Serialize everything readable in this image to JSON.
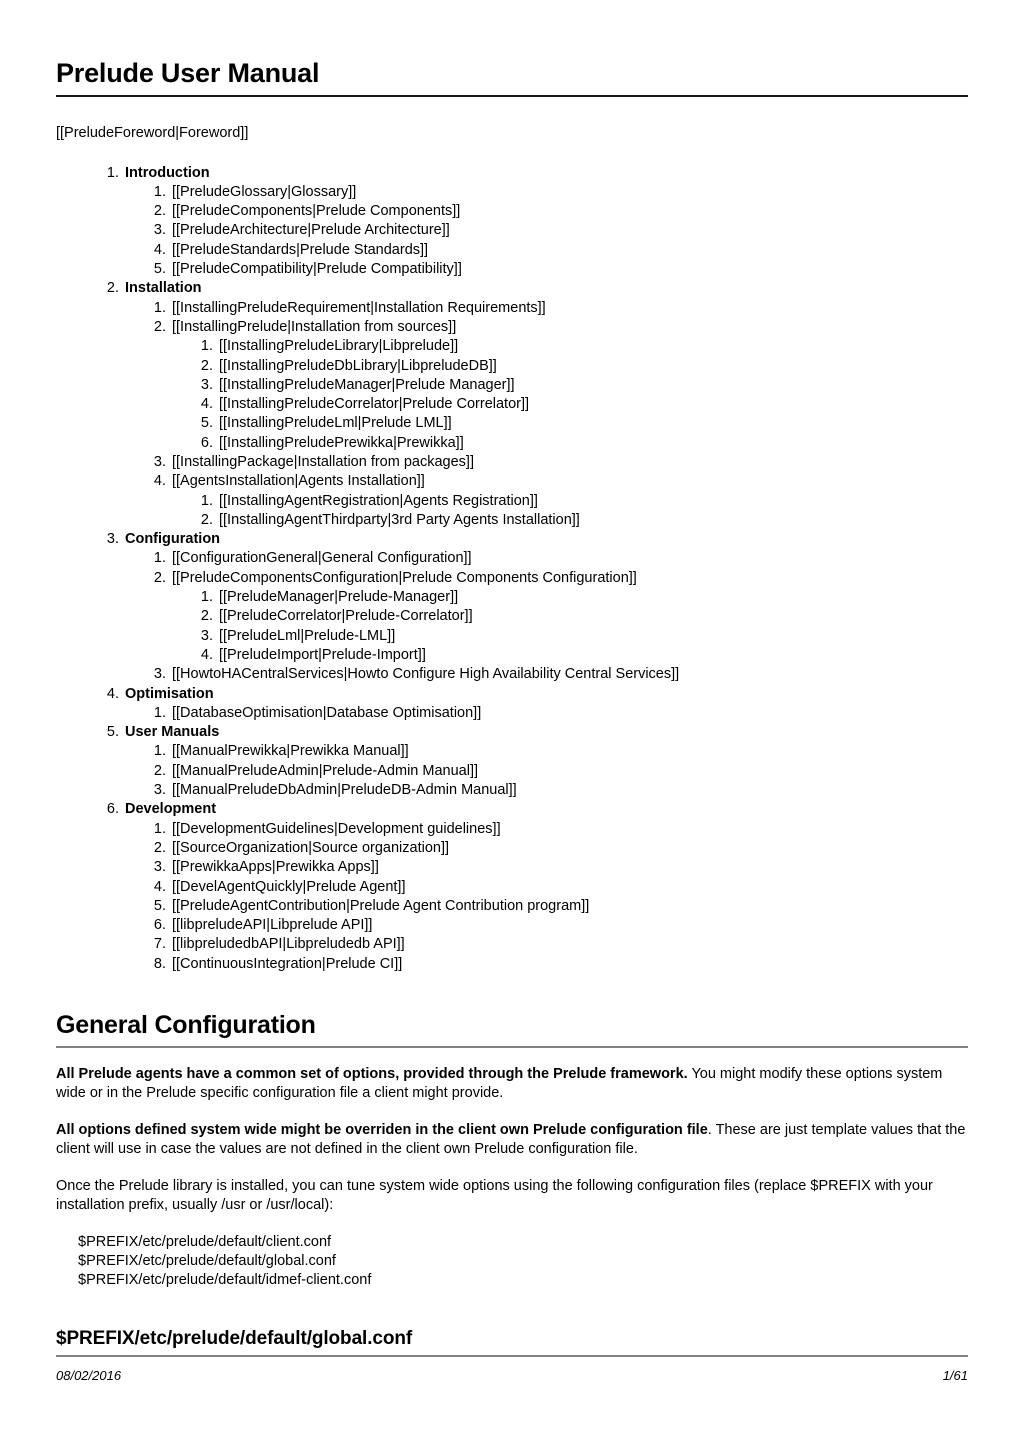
{
  "document": {
    "title": "Prelude User Manual",
    "foreword": "[[PreludeForeword|Foreword]]"
  },
  "toc": [
    {
      "label": "Introduction",
      "children": [
        {
          "label": "[[PreludeGlossary|Glossary]]"
        },
        {
          "label": "[[PreludeComponents|Prelude Components]]"
        },
        {
          "label": "[[PreludeArchitecture|Prelude Architecture]]"
        },
        {
          "label": "[[PreludeStandards|Prelude Standards]]"
        },
        {
          "label": "[[PreludeCompatibility|Prelude Compatibility]]"
        }
      ]
    },
    {
      "label": "Installation",
      "children": [
        {
          "label": "[[InstallingPreludeRequirement|Installation Requirements]]"
        },
        {
          "label": "[[InstallingPrelude|Installation from sources]]",
          "children": [
            {
              "label": "[[InstallingPreludeLibrary|Libprelude]]"
            },
            {
              "label": "[[InstallingPreludeDbLibrary|LibpreludeDB]]"
            },
            {
              "label": "[[InstallingPreludeManager|Prelude Manager]]"
            },
            {
              "label": "[[InstallingPreludeCorrelator|Prelude Correlator]]"
            },
            {
              "label": "[[InstallingPreludeLml|Prelude LML]]"
            },
            {
              "label": "[[InstallingPreludePrewikka|Prewikka]]"
            }
          ]
        },
        {
          "label": "[[InstallingPackage|Installation from packages]]"
        },
        {
          "label": "[[AgentsInstallation|Agents Installation]]",
          "children": [
            {
              "label": "[[InstallingAgentRegistration|Agents Registration]]"
            },
            {
              "label": "[[InstallingAgentThirdparty|3rd Party Agents Installation]]"
            }
          ]
        }
      ]
    },
    {
      "label": "Configuration",
      "children": [
        {
          "label": "[[ConfigurationGeneral|General Configuration]]"
        },
        {
          "label": "[[PreludeComponentsConfiguration|Prelude Components Configuration]]",
          "children": [
            {
              "label": "[[PreludeManager|Prelude-Manager]]"
            },
            {
              "label": "[[PreludeCorrelator|Prelude-Correlator]]"
            },
            {
              "label": "[[PreludeLml|Prelude-LML]]"
            },
            {
              "label": "[[PreludeImport|Prelude-Import]]"
            }
          ]
        },
        {
          "label": "[[HowtoHACentralServices|Howto Configure High Availability Central Services]]"
        }
      ]
    },
    {
      "label": "Optimisation",
      "children": [
        {
          "label": "[[DatabaseOptimisation|Database Optimisation]]"
        }
      ]
    },
    {
      "label": "User Manuals",
      "children": [
        {
          "label": "[[ManualPrewikka|Prewikka Manual]]"
        },
        {
          "label": "[[ManualPreludeAdmin|Prelude-Admin Manual]]"
        },
        {
          "label": "[[ManualPreludeDbAdmin|PreludeDB-Admin Manual]]"
        }
      ]
    },
    {
      "label": "Development",
      "children": [
        {
          "label": "[[DevelopmentGuidelines|Development guidelines]]"
        },
        {
          "label": "[[SourceOrganization|Source organization]]"
        },
        {
          "label": "[[PrewikkaApps|Prewikka Apps]]"
        },
        {
          "label": "[[DevelAgentQuickly|Prelude Agent]]"
        },
        {
          "label": "[[PreludeAgentContribution|Prelude Agent Contribution program]]"
        },
        {
          "label": "[[libpreludeAPI|Libprelude API]]"
        },
        {
          "label": "[[libpreludedbAPI|Libpreludedb API]]"
        },
        {
          "label": "[[ContinuousIntegration|Prelude CI]]"
        }
      ]
    }
  ],
  "section_general": {
    "heading": "General Configuration",
    "paragraph1_bold": "All Prelude agents have a common set of options, provided through the Prelude framework.",
    "paragraph1_rest": " You might modify these options system wide or in the Prelude specific configuration file a client might provide.",
    "paragraph2_bold": "All options defined system wide might be overriden in the client own Prelude configuration file",
    "paragraph2_rest": ". These are just template values that the client will use in case the values are not defined in the client own Prelude configuration file.",
    "paragraph3": "Once the Prelude library is installed, you can tune system wide options using the following configuration files (replace $PREFIX with your installation prefix, usually /usr or /usr/local):",
    "files": [
      "$PREFIX/etc/prelude/default/client.conf",
      "$PREFIX/etc/prelude/default/global.conf",
      "$PREFIX/etc/prelude/default/idmef-client.conf"
    ]
  },
  "section_globalconf": {
    "heading": "$PREFIX/etc/prelude/default/global.conf"
  },
  "footer": {
    "date": "08/02/2016",
    "page": "1/61"
  },
  "colors": {
    "text": "#000000",
    "rule_primary": "#1a1a1a",
    "rule_secondary": "#808080",
    "background": "#ffffff"
  }
}
